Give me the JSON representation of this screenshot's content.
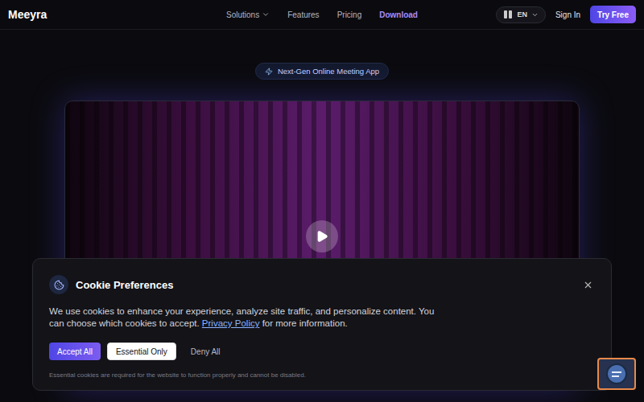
{
  "nav": {
    "logo": "Meeyra",
    "links": [
      {
        "label": "Solutions",
        "has_menu": true,
        "selected": false
      },
      {
        "label": "Features",
        "has_menu": false,
        "selected": false
      },
      {
        "label": "Pricing",
        "has_menu": false,
        "selected": false
      },
      {
        "label": "Download",
        "has_menu": false,
        "selected": true
      }
    ],
    "language": "EN",
    "sign_in": "Sign In",
    "cta": "Try Free"
  },
  "hero": {
    "badge": "Next-Gen Online Meeting App",
    "video": {
      "playing": false
    }
  },
  "cookie_banner": {
    "title": "Cookie Preferences",
    "text_before": "We use cookies to enhance your experience, analyze site traffic, and personalize content. You can choose which cookies to accept. ",
    "link": "Privacy Policy",
    "text_after": " for more information.",
    "buttons": [
      {
        "label": "Accept All",
        "kind": "primary"
      },
      {
        "label": "Essential Only",
        "kind": "secondary"
      },
      {
        "label": "Deny All",
        "kind": "ghost"
      }
    ],
    "note": "Essential cookies are required for the website to function properly and cannot be disabled."
  }
}
